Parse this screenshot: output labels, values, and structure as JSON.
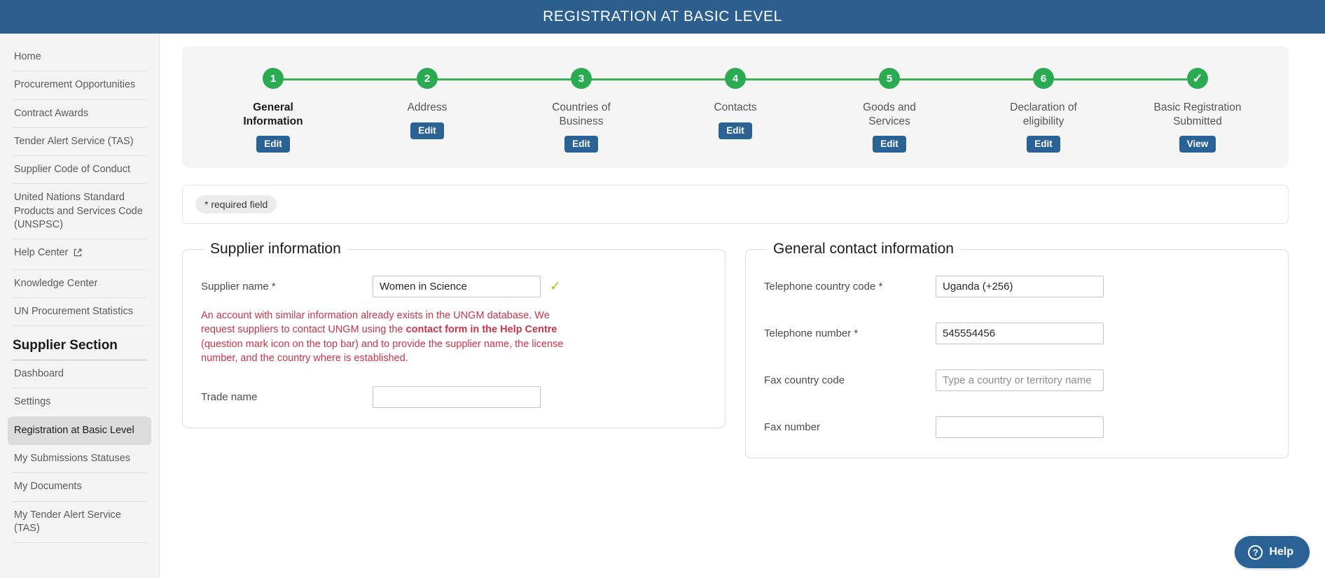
{
  "header": {
    "title": "REGISTRATION AT BASIC LEVEL"
  },
  "colors": {
    "header_blue": "#2c5f8d",
    "button_blue": "#2b6295",
    "step_green": "#2bab51",
    "error_red": "#c8344a",
    "check_green": "#a8c11a"
  },
  "sidebar": {
    "items": [
      {
        "label": "Home"
      },
      {
        "label": "Procurement Opportunities"
      },
      {
        "label": "Contract Awards"
      },
      {
        "label": "Tender Alert Service (TAS)"
      },
      {
        "label": "Supplier Code of Conduct"
      },
      {
        "label": "United Nations Standard Products and Services Code (UNSPSC)"
      },
      {
        "label": "Help Center",
        "icon": "external-link-icon"
      },
      {
        "label": "Knowledge Center"
      },
      {
        "label": "UN Procurement Statistics"
      }
    ],
    "section_title": "Supplier Section",
    "section_items": [
      {
        "label": "Dashboard"
      },
      {
        "label": "Settings"
      },
      {
        "label": "Registration at Basic Level",
        "active": true
      },
      {
        "label": "My Submissions Statuses"
      },
      {
        "label": "My Documents"
      },
      {
        "label": "My Tender Alert Service (TAS)"
      }
    ]
  },
  "stepper": {
    "steps": [
      {
        "marker": "1",
        "label": "General Information",
        "button": "Edit",
        "current": true
      },
      {
        "marker": "2",
        "label": "Address",
        "button": "Edit",
        "current": false
      },
      {
        "marker": "3",
        "label": "Countries of Business",
        "button": "Edit",
        "current": false
      },
      {
        "marker": "4",
        "label": "Contacts",
        "button": "Edit",
        "current": false
      },
      {
        "marker": "5",
        "label": "Goods and Services",
        "button": "Edit",
        "current": false
      },
      {
        "marker": "6",
        "label": "Declaration of eligibility",
        "button": "Edit",
        "current": false
      },
      {
        "marker": "✓",
        "label": "Basic Registration Submitted",
        "button": "View",
        "current": false
      }
    ]
  },
  "required_notice": {
    "pill_label": "* required field"
  },
  "supplier_information": {
    "legend": "Supplier information",
    "supplier_name_label": "Supplier name *",
    "supplier_name_value": "Women in Science",
    "supplier_name_valid_icon": "check-icon",
    "error_part1": "An account with similar information already exists in the UNGM database. We request suppliers to contact UNGM using the ",
    "error_bold": "contact form in the Help Centre",
    "error_part2": " (question mark icon on the top bar) and to provide the supplier name, the license number, and the country where is established.",
    "trade_name_label": "Trade name",
    "trade_name_value": ""
  },
  "general_contact_information": {
    "legend": "General contact information",
    "telephone_country_code_label": "Telephone country code *",
    "telephone_country_code_value": "Uganda (+256)",
    "telephone_number_label": "Telephone number *",
    "telephone_number_value": "545554456",
    "fax_country_code_label": "Fax country code",
    "fax_country_code_value": "",
    "fax_country_code_placeholder": "Type a country or territory name",
    "fax_number_label": "Fax number",
    "fax_number_value": ""
  },
  "help_widget": {
    "label": "Help",
    "icon": "question-mark-icon"
  }
}
